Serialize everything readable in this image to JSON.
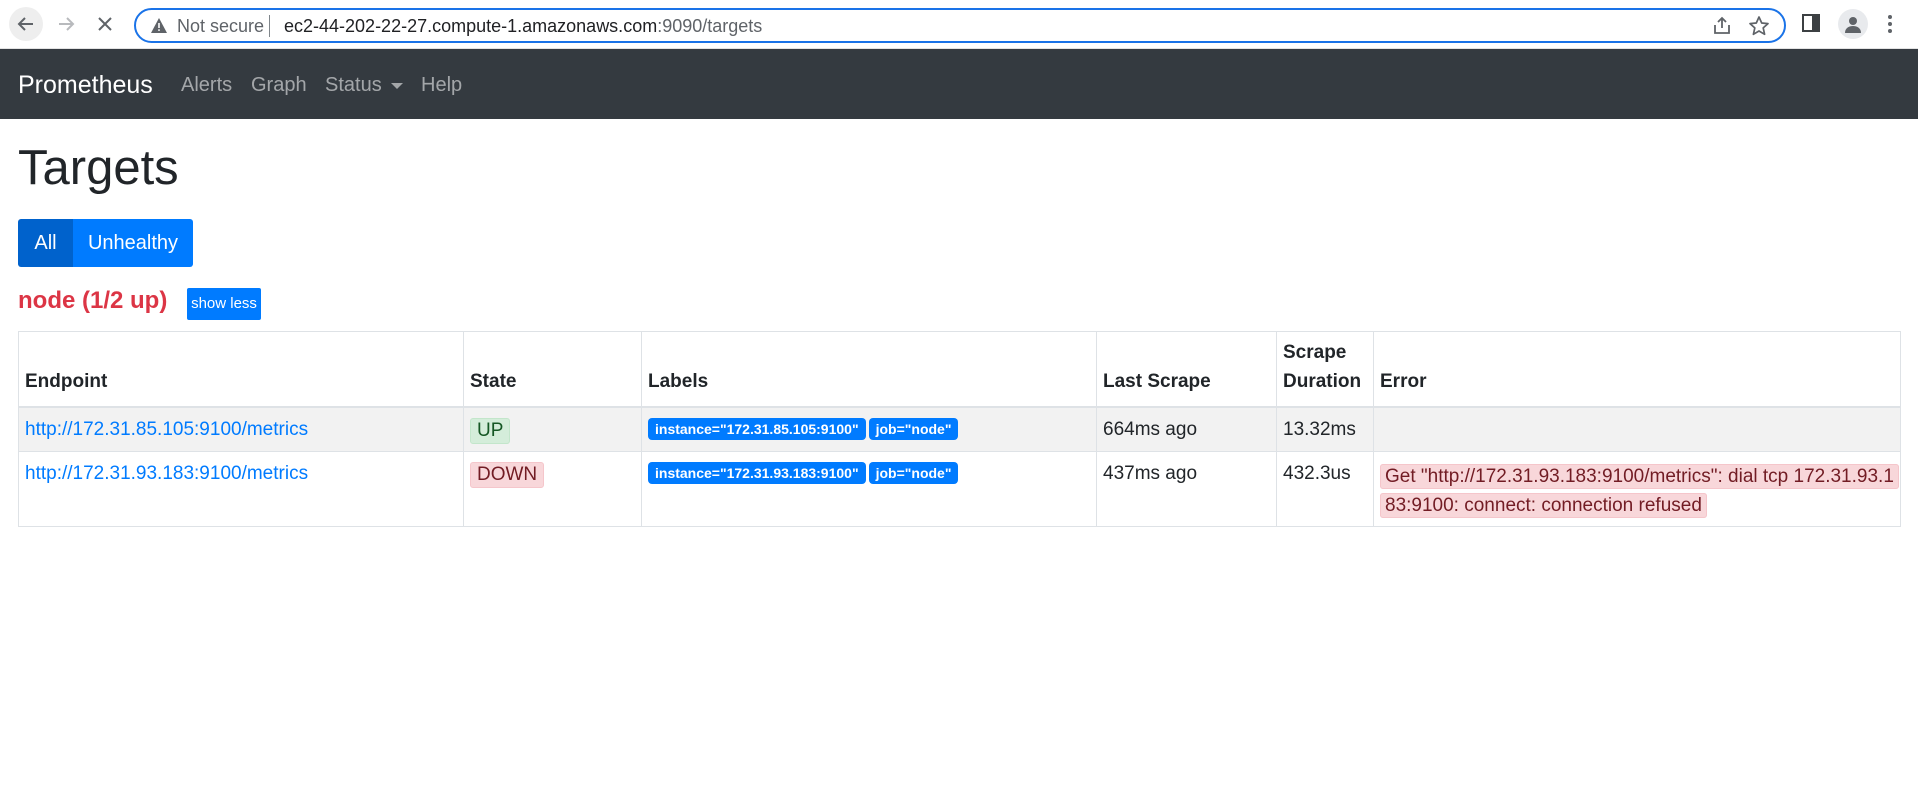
{
  "browser": {
    "security_label": "Not secure",
    "url_host": "ec2-44-202-22-27.compute-1.amazonaws.com",
    "url_rest": ":9090/targets"
  },
  "navbar": {
    "brand": "Prometheus",
    "links": {
      "alerts": "Alerts",
      "graph": "Graph",
      "status": "Status",
      "help": "Help"
    }
  },
  "page": {
    "title": "Targets",
    "filters": {
      "all": "All",
      "unhealthy": "Unhealthy"
    }
  },
  "job": {
    "title": "node (1/2 up)",
    "toggle_label": "show less",
    "columns": {
      "endpoint": "Endpoint",
      "state": "State",
      "labels": "Labels",
      "last_scrape": "Last Scrape",
      "scrape_duration_1": "Scrape",
      "scrape_duration_2": "Duration",
      "error": "Error"
    },
    "targets": [
      {
        "endpoint": "http://172.31.85.105:9100/metrics",
        "state": "UP",
        "labels": [
          "instance=\"172.31.85.105:9100\"",
          "job=\"node\""
        ],
        "last_scrape": "664ms ago",
        "scrape_duration": "13.32ms",
        "error": ""
      },
      {
        "endpoint": "http://172.31.93.183:9100/metrics",
        "state": "DOWN",
        "labels": [
          "instance=\"172.31.93.183:9100\"",
          "job=\"node\""
        ],
        "last_scrape": "437ms ago",
        "scrape_duration": "432.3us",
        "error": "Get \"http://172.31.93.183:9100/metrics\": dial tcp 172.31.93.183:9100: connect: connection refused"
      }
    ]
  },
  "colors": {
    "navbar_bg": "#343a40",
    "primary": "#007bff",
    "danger": "#dc3545",
    "up_bg": "#d4edda",
    "down_bg": "#f8d7da"
  }
}
